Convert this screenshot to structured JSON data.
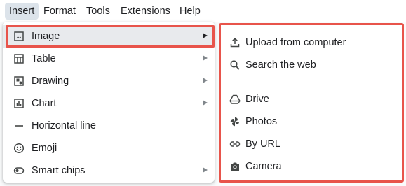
{
  "menubar": {
    "items": [
      {
        "label": "Insert",
        "active": true
      },
      {
        "label": "Format"
      },
      {
        "label": "Tools"
      },
      {
        "label": "Extensions"
      },
      {
        "label": "Help"
      }
    ]
  },
  "insert_menu": {
    "items": [
      {
        "label": "Image",
        "icon": "image-icon",
        "has_submenu": true,
        "highlighted": true
      },
      {
        "label": "Table",
        "icon": "table-icon",
        "has_submenu": true
      },
      {
        "label": "Drawing",
        "icon": "drawing-icon",
        "has_submenu": true
      },
      {
        "label": "Chart",
        "icon": "chart-icon",
        "has_submenu": true
      },
      {
        "label": "Horizontal line",
        "icon": "horizontal-line-icon",
        "has_submenu": false
      },
      {
        "label": "Emoji",
        "icon": "emoji-icon",
        "has_submenu": false
      },
      {
        "label": "Smart chips",
        "icon": "smart-chips-icon",
        "has_submenu": true
      }
    ]
  },
  "image_submenu": {
    "items": [
      {
        "label": "Upload from computer",
        "icon": "upload-icon"
      },
      {
        "label": "Search the web",
        "icon": "search-icon"
      },
      {
        "label": "Drive",
        "icon": "drive-icon"
      },
      {
        "label": "Photos",
        "icon": "photos-icon"
      },
      {
        "label": "By URL",
        "icon": "link-icon"
      },
      {
        "label": "Camera",
        "icon": "camera-icon"
      }
    ]
  },
  "colors": {
    "highlight_border": "#e8544b",
    "hover_bg": "#e8eaed",
    "icon": "#444746",
    "text": "#202124"
  }
}
